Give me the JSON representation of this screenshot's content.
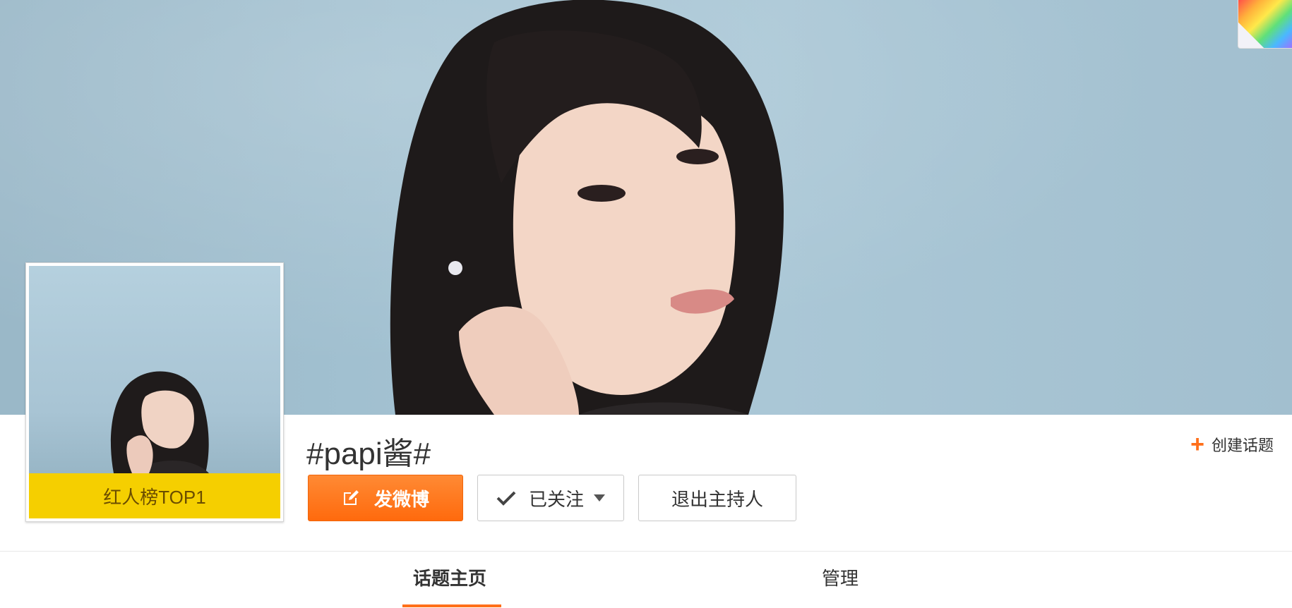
{
  "banner": {
    "background_color": "#a3c2d2",
    "image_subject": "portrait photo of a woman with dark hair against a light blue wall"
  },
  "avatar": {
    "badge_text": "红人榜TOP1",
    "badge_color": "#f5cf00"
  },
  "topic": {
    "title": "#papi酱#"
  },
  "actions": {
    "post_label": "发微博",
    "post_icon": "edit-icon",
    "follow_label": "已关注",
    "follow_icon": "check-icon",
    "follow_caret_icon": "caret-down-icon",
    "quit_host_label": "退出主持人",
    "accent_color": "#ff7317"
  },
  "create_topic": {
    "icon": "plus-icon",
    "label": "创建话题"
  },
  "tabs": [
    {
      "label": "话题主页",
      "active": true
    },
    {
      "label": "管理",
      "active": false
    }
  ]
}
